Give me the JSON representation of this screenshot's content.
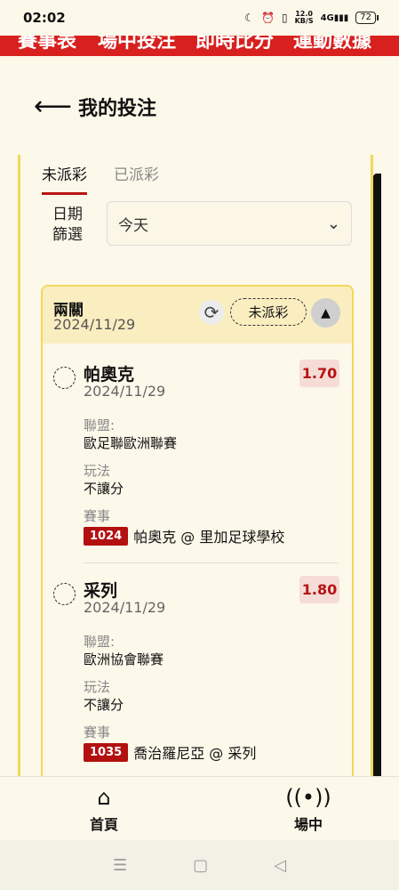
{
  "status_bar": {
    "time": "02:02",
    "speed_value": "12.0",
    "speed_unit": "KB/S",
    "network": "4G",
    "battery": "72"
  },
  "top_nav": {
    "items": [
      "賽事表",
      "場中投注",
      "即時比分",
      "運動數據"
    ]
  },
  "header": {
    "title": "我的投注"
  },
  "tabs": [
    {
      "label": "未派彩",
      "active": true
    },
    {
      "label": "已派彩",
      "active": false
    }
  ],
  "filter": {
    "label_line1": "日期",
    "label_line2": "篩選",
    "value": "今天"
  },
  "bet_group": {
    "type": "兩關",
    "date": "2024/11/29",
    "status": "未派彩",
    "selections": [
      {
        "name": "帕奧克",
        "date": "2024/11/29",
        "odds": "1.70",
        "league_label": "聯盟:",
        "league": "歐足聯歐洲聯賽",
        "bet_type_label": "玩法",
        "bet_type": "不讓分",
        "match_label": "賽事",
        "match_no": "1024",
        "match": "帕奧克 @ 里加足球學校"
      },
      {
        "name": "采列",
        "date": "2024/11/29",
        "odds": "1.80",
        "league_label": "聯盟:",
        "league": "歐洲協會聯賽",
        "bet_type_label": "玩法",
        "bet_type": "不讓分",
        "match_label": "賽事",
        "match_no": "1035",
        "match": "喬治羅尼亞 @ 采列"
      }
    ]
  },
  "bottom_nav": {
    "home_label": "首頁",
    "live_label": "場中"
  },
  "colors": {
    "brand_red": "#d8201f",
    "accent_yellow": "#f3d85a",
    "background": "#fcf8ea"
  }
}
